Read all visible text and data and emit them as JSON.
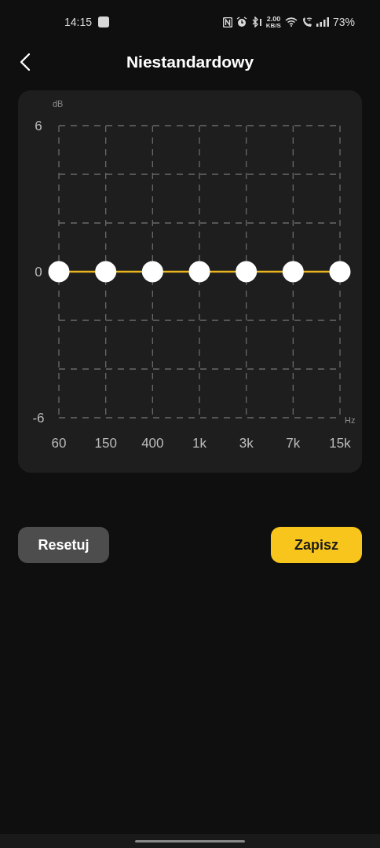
{
  "status_bar": {
    "time": "14:15",
    "network_speed": "2.00",
    "network_speed_unit": "KB/S",
    "battery": "73%"
  },
  "header": {
    "title": "Niestandardowy"
  },
  "equalizer": {
    "chart_data": {
      "type": "line",
      "ylabel": "dB",
      "xlabel": "Hz",
      "categories": [
        "60",
        "150",
        "400",
        "1k",
        "3k",
        "7k",
        "15k"
      ],
      "ylim": [
        -6,
        6
      ],
      "yticks": [
        6,
        0,
        -6
      ],
      "grid": true,
      "series": [
        {
          "color": "#e9b51f",
          "marker": true,
          "values": [
            0,
            0,
            0,
            0,
            0,
            0,
            0
          ]
        }
      ]
    }
  },
  "buttons": [
    {
      "label": "Resetuj",
      "kind": "secondary"
    },
    {
      "label": "Zapisz",
      "kind": "primary"
    }
  ]
}
